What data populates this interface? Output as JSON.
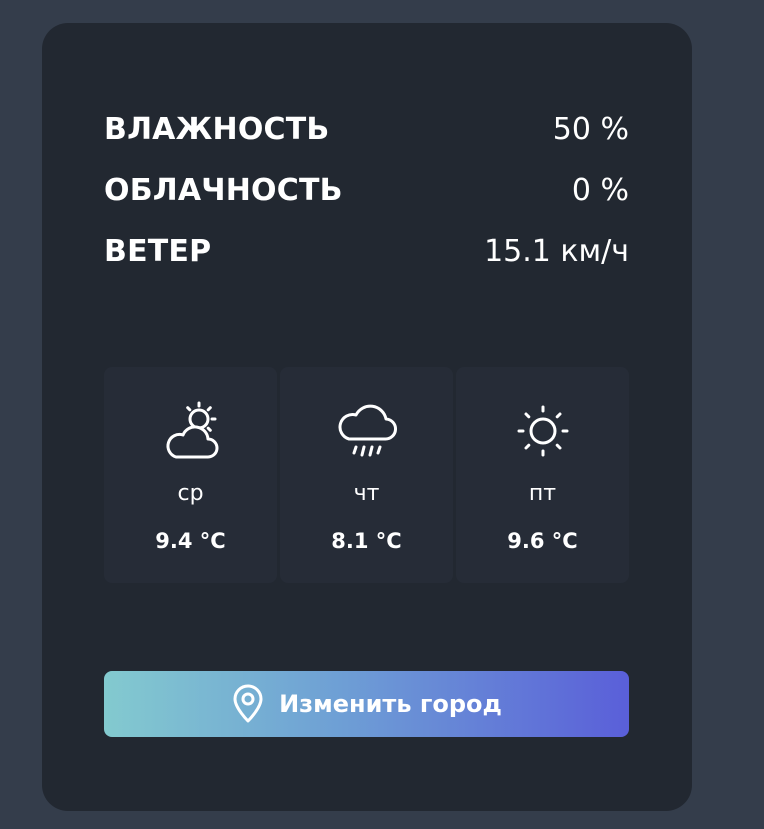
{
  "stats": [
    {
      "label": "ВЛАЖНОСТЬ",
      "value": "50 %"
    },
    {
      "label": "ОБЛАЧНОСТЬ",
      "value": "0 %"
    },
    {
      "label": "ВЕТЕР",
      "value": "15.1 км/ч"
    }
  ],
  "forecast": [
    {
      "day": "ср",
      "temp": "9.4 °C",
      "icon": "partly-cloudy-icon"
    },
    {
      "day": "чт",
      "temp": "8.1 °C",
      "icon": "rain-cloud-icon"
    },
    {
      "day": "пт",
      "temp": "9.6 °C",
      "icon": "sun-icon"
    }
  ],
  "change_city": {
    "label": "Изменить город",
    "icon": "location-pin-icon"
  },
  "colors": {
    "page_background": "#343d4b",
    "card_background": "#222831",
    "tile_background": "#262c37",
    "button_gradient_start": "#83cacf",
    "button_gradient_end": "#5a5fd9",
    "text": "#ffffff"
  }
}
